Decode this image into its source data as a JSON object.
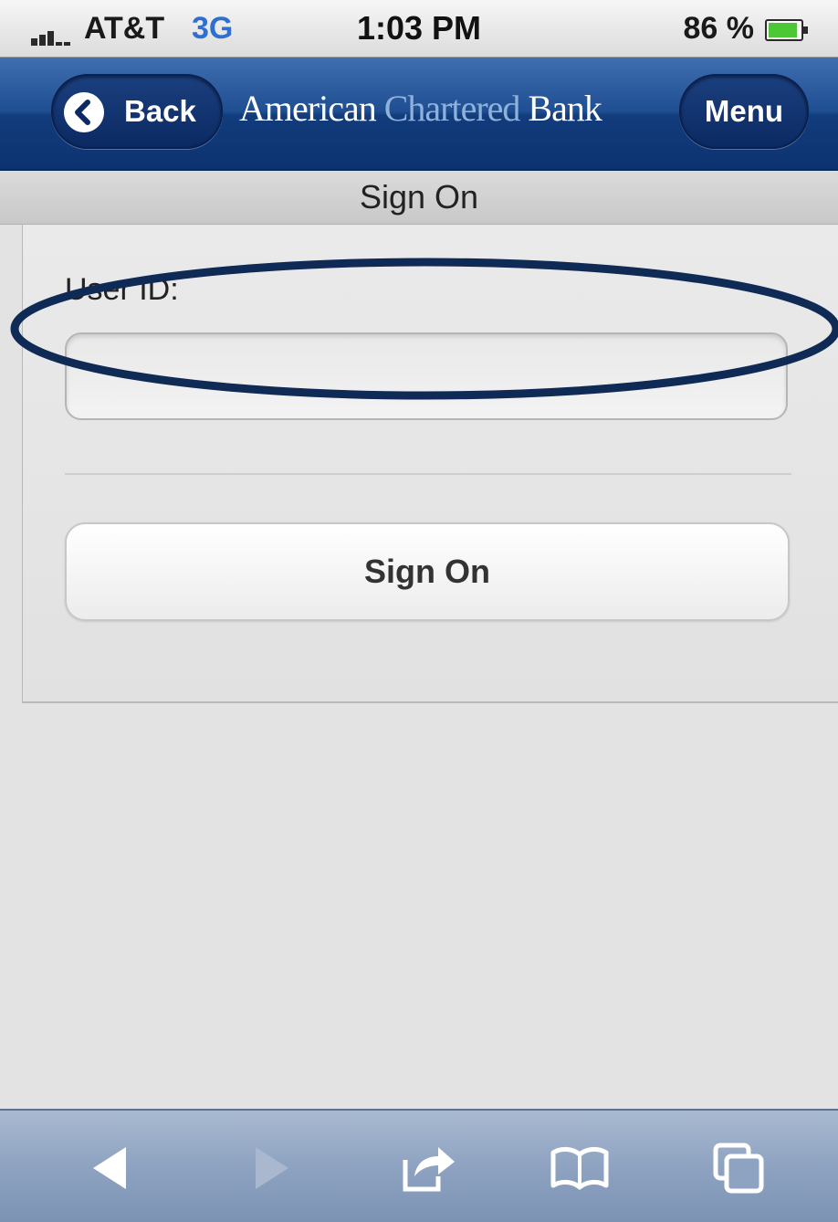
{
  "status_bar": {
    "carrier": "AT&T",
    "network": "3G",
    "time": "1:03 PM",
    "battery_percent": "86 %",
    "colors": {
      "network": "#2f6fd0",
      "battery_fill": "#4ec736"
    }
  },
  "header": {
    "back_label": "Back",
    "brand_part_1": "American ",
    "brand_part_2": "Chartered ",
    "brand_part_3": "Bank",
    "menu_label": "Menu",
    "colors": {
      "bar": "#1f4f92",
      "brand_accent": "#8fb2dc"
    }
  },
  "page": {
    "title": "Sign On"
  },
  "form": {
    "userid_label": "User ID:",
    "userid_value": "",
    "signon_label": "Sign On"
  },
  "annotation": {
    "color": "#0f2a55",
    "target": "userid-field"
  },
  "toolbar": {
    "icons": [
      "back-arrow-icon",
      "forward-arrow-icon",
      "share-icon",
      "bookmarks-icon",
      "tabs-icon"
    ]
  }
}
